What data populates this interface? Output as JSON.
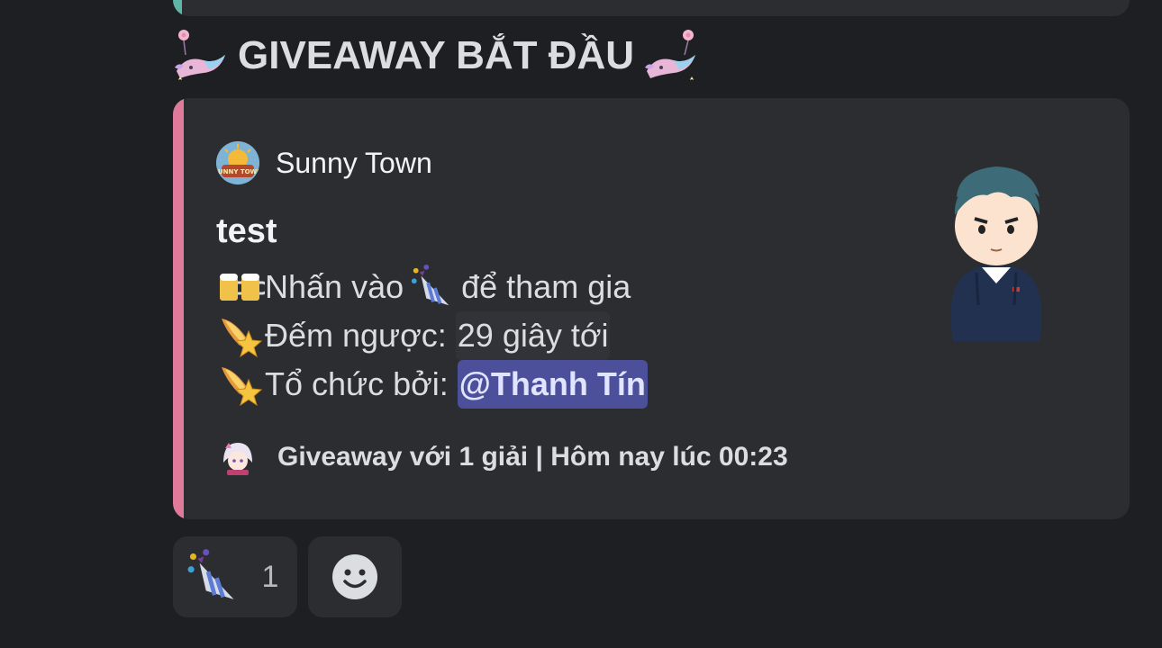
{
  "heading": {
    "title": "GIVEAWAY BẮT ĐẦU",
    "left_icon": "fairy-whale-icon",
    "right_icon": "fairy-whale-icon"
  },
  "embed": {
    "accent_color": "#e07a9b",
    "author": {
      "icon": "sunny-town-logo",
      "icon_text": "SUNNY TOWN",
      "name": "Sunny Town"
    },
    "title": "test",
    "lines": [
      {
        "icon": "beer-mugs-icon",
        "prefix": "Nhấn vào",
        "mid_icon": "party-popper-icon",
        "suffix": "để tham gia"
      },
      {
        "icon": "shooting-star-icon",
        "label": "Đếm ngược:",
        "value": "29 giây tới"
      },
      {
        "icon": "shooting-star-icon",
        "label": "Tổ chức bởi:",
        "mention": "@Thanh Tín"
      }
    ],
    "thumbnail": "avatar-boy-hoodie",
    "footer": {
      "icon": "anime-girl-avatar",
      "text": "Giveaway với 1 giải | Hôm nay lúc 00:23"
    }
  },
  "reactions": [
    {
      "emoji": "party-popper-icon",
      "count": "1"
    },
    {
      "emoji": "add-reaction-icon"
    }
  ],
  "colors": {
    "background": "#1e1f22",
    "embed_bg": "#2b2d31",
    "mention_bg": "#4c4f9a",
    "prev_accent": "#5fb6a8"
  }
}
